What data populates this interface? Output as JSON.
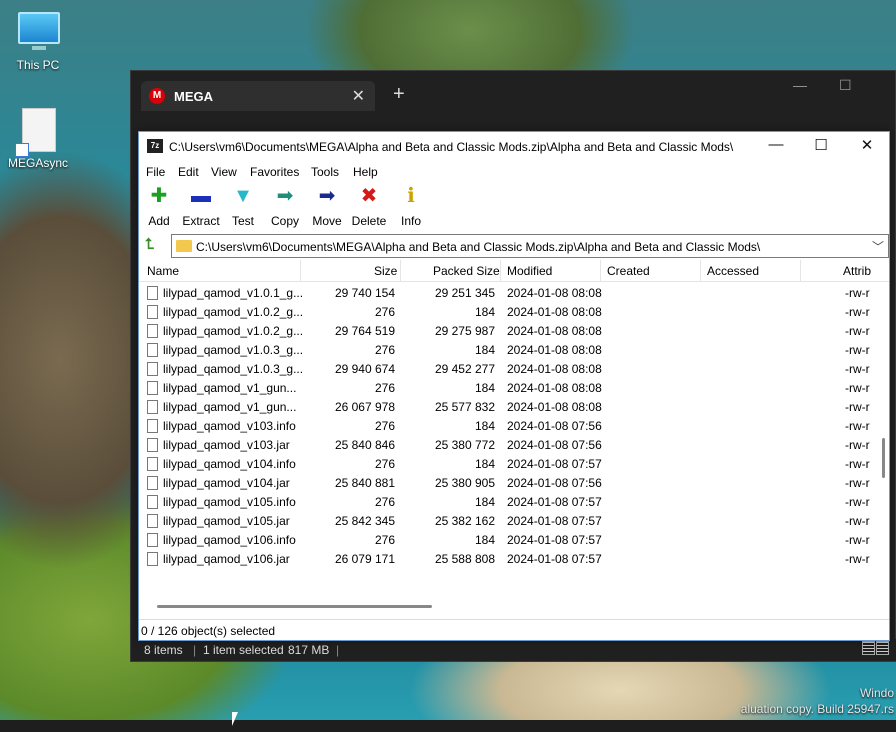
{
  "desktop": {
    "icons": [
      {
        "label": "This PC"
      },
      {
        "label": "MEGAsync"
      }
    ],
    "watermark": {
      "line1": "Windo",
      "line2": "aluation copy. Build 25947.rs"
    }
  },
  "mega": {
    "logo_letter": "M",
    "tab_title": "MEGA",
    "close_glyph": "✕",
    "newtab_glyph": "+",
    "status": {
      "items": "8 items",
      "selected": "1 item selected",
      "size": "817 MB"
    }
  },
  "zip": {
    "title_icon": "7z",
    "title": "C:\\Users\\vm6\\Documents\\MEGA\\Alpha and Beta and Classic Mods.zip\\Alpha and Beta and Classic Mods\\",
    "controls": {
      "minimize": "—",
      "maximize": "☐",
      "close": "✕"
    },
    "menu": [
      "File",
      "Edit",
      "View",
      "Favorites",
      "Tools",
      "Help"
    ],
    "toolbar": [
      {
        "label": "Add",
        "icon": "add-icon",
        "glyph": "✚",
        "color": "#19a11f"
      },
      {
        "label": "Extract",
        "icon": "extract-icon",
        "glyph": "▬",
        "color": "#1b2fb8"
      },
      {
        "label": "Test",
        "icon": "test-icon",
        "glyph": "▼",
        "color": "#27b8c8"
      },
      {
        "label": "Copy",
        "icon": "copy-icon",
        "glyph": "➡",
        "color": "#1e8f7a"
      },
      {
        "label": "Move",
        "icon": "move-icon",
        "glyph": "➡",
        "color": "#1b2a8f"
      },
      {
        "label": "Delete",
        "icon": "delete-icon",
        "glyph": "✖",
        "color": "#d61a1a"
      },
      {
        "label": "Info",
        "icon": "info-icon",
        "glyph": "ℹ",
        "color": "#caa300"
      }
    ],
    "address": "C:\\Users\\vm6\\Documents\\MEGA\\Alpha and Beta and Classic Mods.zip\\Alpha and Beta and Classic Mods\\",
    "columns": [
      "Name",
      "Size",
      "Packed Size",
      "Modified",
      "Created",
      "Accessed",
      "Attrib"
    ],
    "rows": [
      {
        "name": "lilypad_qamod_v1.0.1_g...",
        "size": "29 740 154",
        "packed": "29 251 345",
        "modified": "2024-01-08 08:08",
        "attrib": "-rw-r"
      },
      {
        "name": "lilypad_qamod_v1.0.2_g...",
        "size": "276",
        "packed": "184",
        "modified": "2024-01-08 08:08",
        "attrib": "-rw-r"
      },
      {
        "name": "lilypad_qamod_v1.0.2_g...",
        "size": "29 764 519",
        "packed": "29 275 987",
        "modified": "2024-01-08 08:08",
        "attrib": "-rw-r"
      },
      {
        "name": "lilypad_qamod_v1.0.3_g...",
        "size": "276",
        "packed": "184",
        "modified": "2024-01-08 08:08",
        "attrib": "-rw-r"
      },
      {
        "name": "lilypad_qamod_v1.0.3_g...",
        "size": "29 940 674",
        "packed": "29 452 277",
        "modified": "2024-01-08 08:08",
        "attrib": "-rw-r"
      },
      {
        "name": "lilypad_qamod_v1_gun...",
        "size": "276",
        "packed": "184",
        "modified": "2024-01-08 08:08",
        "attrib": "-rw-r"
      },
      {
        "name": "lilypad_qamod_v1_gun...",
        "size": "26 067 978",
        "packed": "25 577 832",
        "modified": "2024-01-08 08:08",
        "attrib": "-rw-r"
      },
      {
        "name": "lilypad_qamod_v103.info",
        "size": "276",
        "packed": "184",
        "modified": "2024-01-08 07:56",
        "attrib": "-rw-r"
      },
      {
        "name": "lilypad_qamod_v103.jar",
        "size": "25 840 846",
        "packed": "25 380 772",
        "modified": "2024-01-08 07:56",
        "attrib": "-rw-r"
      },
      {
        "name": "lilypad_qamod_v104.info",
        "size": "276",
        "packed": "184",
        "modified": "2024-01-08 07:57",
        "attrib": "-rw-r"
      },
      {
        "name": "lilypad_qamod_v104.jar",
        "size": "25 840 881",
        "packed": "25 380 905",
        "modified": "2024-01-08 07:56",
        "attrib": "-rw-r"
      },
      {
        "name": "lilypad_qamod_v105.info",
        "size": "276",
        "packed": "184",
        "modified": "2024-01-08 07:57",
        "attrib": "-rw-r"
      },
      {
        "name": "lilypad_qamod_v105.jar",
        "size": "25 842 345",
        "packed": "25 382 162",
        "modified": "2024-01-08 07:57",
        "attrib": "-rw-r"
      },
      {
        "name": "lilypad_qamod_v106.info",
        "size": "276",
        "packed": "184",
        "modified": "2024-01-08 07:57",
        "attrib": "-rw-r"
      },
      {
        "name": "lilypad_qamod_v106.jar",
        "size": "26 079 171",
        "packed": "25 588 808",
        "modified": "2024-01-08 07:57",
        "attrib": "-rw-r"
      }
    ],
    "status": "0 / 126 object(s) selected"
  }
}
